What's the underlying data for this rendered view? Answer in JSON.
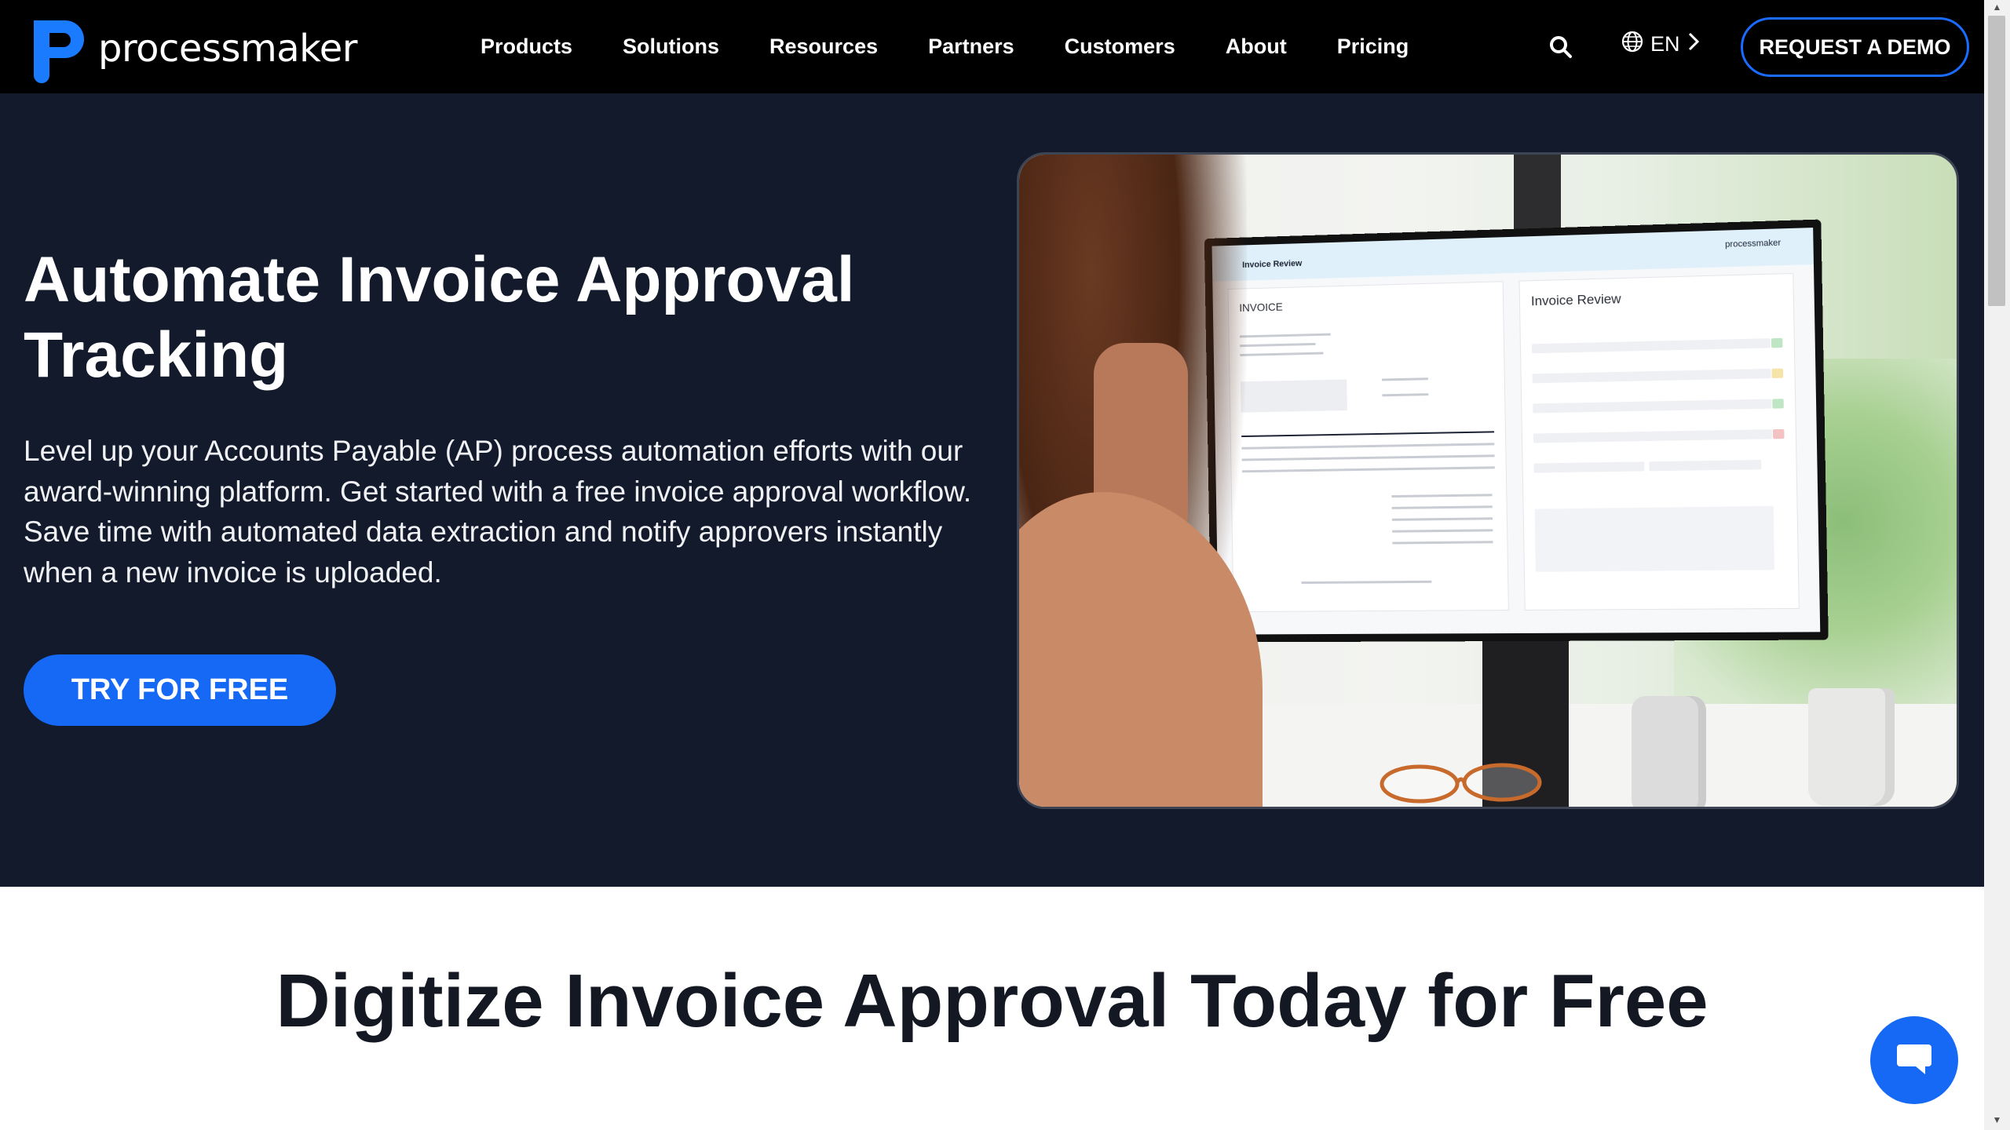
{
  "brand": {
    "name": "processmaker",
    "accent": "#1569f5"
  },
  "nav": {
    "links": [
      "Products",
      "Solutions",
      "Resources",
      "Partners",
      "Customers",
      "About",
      "Pricing"
    ],
    "language": "EN",
    "demo_label": "REQUEST A DEMO"
  },
  "hero": {
    "title": "Automate Invoice Approval Tracking",
    "description": "Level up your Accounts Payable (AP) process automation efforts with our award-winning platform. Get started with a free invoice approval workflow. Save time with automated data extraction and notify approvers instantly when a new invoice is uploaded.",
    "cta_label": "TRY FOR FREE",
    "image": {
      "screen_title": "Invoice Review",
      "screen_logo": "processmaker",
      "invoice_heading": "INVOICE",
      "review_heading": "Invoice Review"
    }
  },
  "section2": {
    "title": "Digitize Invoice Approval Today for Free"
  },
  "icons": {
    "search": "search-icon",
    "globe": "globe-icon",
    "chevron": "chevron-right-icon",
    "chat": "chat-icon"
  }
}
